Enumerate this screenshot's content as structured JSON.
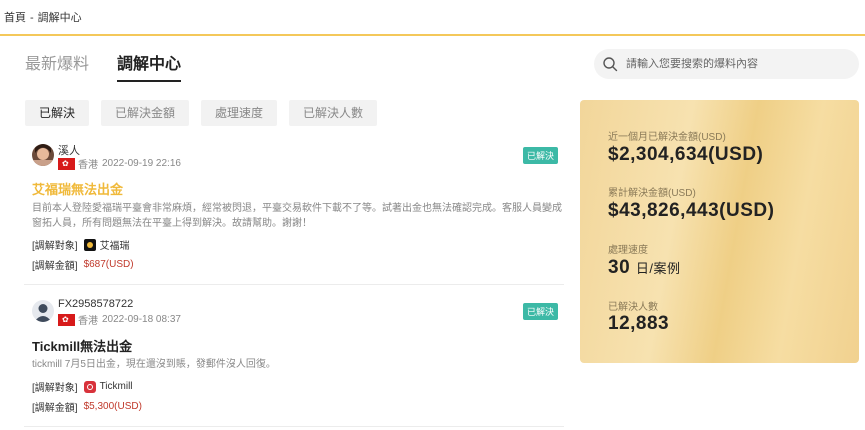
{
  "breadcrumb": {
    "home": "首頁",
    "separator": "-",
    "current": "調解中心"
  },
  "tabs": [
    {
      "label": "最新爆料",
      "active": false
    },
    {
      "label": "調解中心",
      "active": true
    }
  ],
  "search": {
    "placeholder": "請輸入您要搜索的爆料內容"
  },
  "filters": [
    {
      "label": "已解決",
      "active": true
    },
    {
      "label": "已解決金額",
      "active": false
    },
    {
      "label": "處理速度",
      "active": false
    },
    {
      "label": "已解決人數",
      "active": false
    }
  ],
  "cases": [
    {
      "user": "溪人",
      "location": "香港",
      "datetime": "2022-09-19 22:16",
      "status": "已解決",
      "title": "艾福瑞無法出金",
      "description": "目前本人登陸愛福瑞平臺會非常麻煩，經常被閃退，平臺交易軟件下載不了等。試著出金也無法確認完成。客服人員變成窗拓人員，所有問題無法在平臺上得到解決。故請幫助。謝謝！",
      "object_label": "[調解對象]",
      "broker": "艾福瑞",
      "amount_label": "[調解金額]",
      "amount": "$687(USD)"
    },
    {
      "user": "FX2958578722",
      "location": "香港",
      "datetime": "2022-09-18 08:37",
      "status": "已解決",
      "title": "Tickmill無法出金",
      "description": "tickmill 7月5日出金，現在還沒到賬，發郵件沒人回復。",
      "object_label": "[調解對象]",
      "broker": "Tickmill",
      "amount_label": "[調解金額]",
      "amount": "$5,300(USD)"
    }
  ],
  "stats": {
    "month_label": "近一個月已解決金額(USD)",
    "month_value": "$2,304,634(USD)",
    "total_label": "累計解決金額(USD)",
    "total_value": "$43,826,443(USD)",
    "speed_label": "處理速度",
    "speed_value": "30",
    "speed_unit": "日/案例",
    "people_label": "已解決人數",
    "people_value": "12,883"
  },
  "colors": {
    "accent": "#f4c85a",
    "title_highlight": "#f0b93a",
    "badge": "#3cb9a6",
    "amount": "#c0392b"
  }
}
